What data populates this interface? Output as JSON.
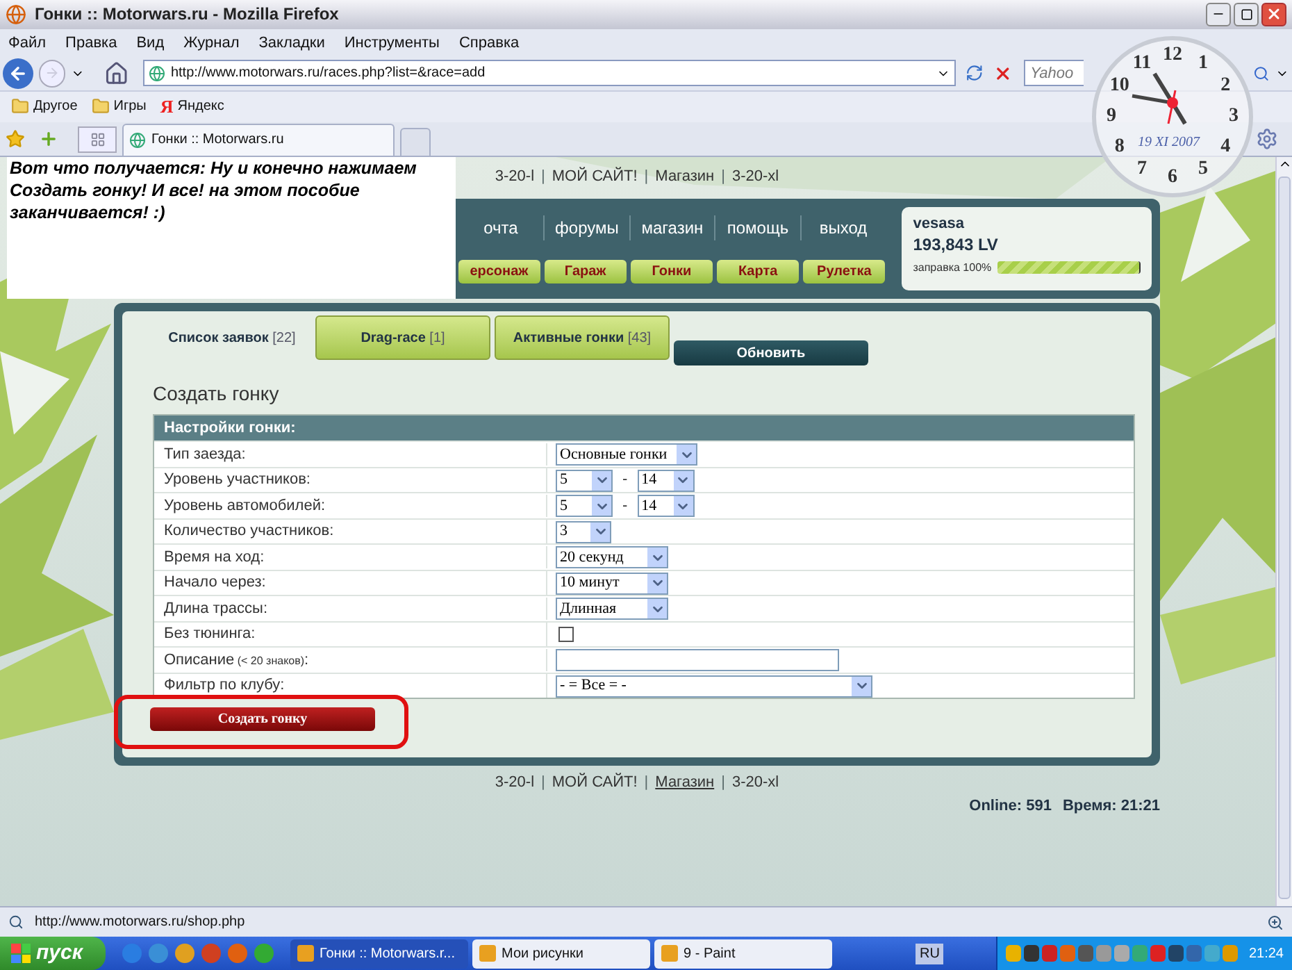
{
  "window": {
    "title": "Гонки :: Motorwars.ru - Mozilla Firefox"
  },
  "menu": [
    "Файл",
    "Правка",
    "Вид",
    "Журнал",
    "Закладки",
    "Инструменты",
    "Справка"
  ],
  "address": {
    "url": "http://www.motorwars.ru/races.php?list=&race=add",
    "search_placeholder": "Yahoo"
  },
  "bookmarks": [
    {
      "label": "Другое",
      "kind": "folder"
    },
    {
      "label": "Игры",
      "kind": "folder"
    },
    {
      "label": "Яндекс",
      "kind": "yandex",
      "glyph": "Я"
    }
  ],
  "browser_tabs": [
    {
      "label": "Гонки :: Motorwars.ru",
      "selected": true
    }
  ],
  "note": {
    "text": "Вот что получается: Ну и конечно нажимаем\nСоздать гонку! И все! на этом пособие\nзаканчивается! :)"
  },
  "clock": {
    "numerals": [
      "12",
      "1",
      "2",
      "3",
      "4",
      "5",
      "6",
      "7",
      "8",
      "9",
      "10",
      "11"
    ],
    "date": "19 XI 2007"
  },
  "site": {
    "top_links": [
      {
        "kind": "link",
        "label": "3-20-l",
        "underlined": false
      },
      {
        "kind": "separator",
        "label": "|"
      },
      {
        "kind": "link",
        "label": "МОЙ САЙТ!",
        "underlined": false
      },
      {
        "kind": "separator",
        "label": "|"
      },
      {
        "kind": "link",
        "label": "Магазин",
        "underlined": false
      },
      {
        "kind": "separator",
        "label": "|"
      },
      {
        "kind": "link",
        "label": "3-20-xl",
        "underlined": false
      }
    ],
    "nav": [
      "очта",
      "форумы",
      "магазин",
      "помощь",
      "выход"
    ],
    "nav_buttons": [
      "ерсонаж",
      "Гараж",
      "Гонки",
      "Карта",
      "Рулетка"
    ],
    "user": {
      "name": "vesasa",
      "balance": "193,843 LV",
      "fuel_label": "заправка 100%",
      "level": 1
    },
    "tabs": [
      {
        "label": "Список заявок",
        "count": "[22]",
        "selected": true
      },
      {
        "label": "Drag-race",
        "count": "[1]",
        "selected": false
      },
      {
        "label": "Активные гонки",
        "count": "[43]",
        "selected": false
      }
    ],
    "refresh_button": "Обновить",
    "heading": "Создать гонку",
    "settings": {
      "title": "Настройки гонки:",
      "rows": [
        {
          "label": "Тип заезда:",
          "kind": "select",
          "value": "Основные гонки"
        },
        {
          "label": "Уровень участников:",
          "kind": "range",
          "from": "5",
          "separator": "-",
          "to": "14"
        },
        {
          "label": "Уровень автомобилей:",
          "kind": "range",
          "from": "5",
          "separator": "-",
          "to": "14"
        },
        {
          "label": "Количество участников:",
          "kind": "select",
          "value": "3"
        },
        {
          "label": "Время на ход:",
          "kind": "select",
          "value": "20 секунд"
        },
        {
          "label": "Начало через:",
          "kind": "select",
          "value": "10 минут"
        },
        {
          "label": "Длина трассы:",
          "kind": "select",
          "value": "Длинная"
        },
        {
          "label": "Без тюнинга:",
          "kind": "checkbox",
          "checked": false
        },
        {
          "label": "Описание",
          "note": "(< 20 знаков)",
          "suffix": ":",
          "kind": "text"
        },
        {
          "label": "Фильтр по клубу:",
          "kind": "select",
          "value": "- = Все = -"
        }
      ]
    },
    "submit": "Создать гонку",
    "footer_links": [
      {
        "kind": "link",
        "label": "3-20-l",
        "underlined": false
      },
      {
        "kind": "separator",
        "label": "|"
      },
      {
        "kind": "link",
        "label": "МОЙ САЙТ!",
        "underlined": false
      },
      {
        "kind": "separator",
        "label": "|"
      },
      {
        "kind": "link",
        "label": "Магазин",
        "underlined": true
      },
      {
        "kind": "separator",
        "label": "|"
      },
      {
        "kind": "link",
        "label": "3-20-xl",
        "underlined": false
      }
    ],
    "online": "Online: 591",
    "time": "Время: 21:21"
  },
  "status_bar": {
    "url": "http://www.motorwars.ru/shop.php"
  },
  "taskbar": {
    "start": "пуск",
    "tasks": [
      {
        "label": "Гонки :: Motorwars.r...",
        "selected": true
      },
      {
        "label": "Мои рисунки",
        "selected": false
      },
      {
        "label": "9 - Paint",
        "selected": false
      }
    ],
    "language": "RU",
    "time": "21:24"
  }
}
